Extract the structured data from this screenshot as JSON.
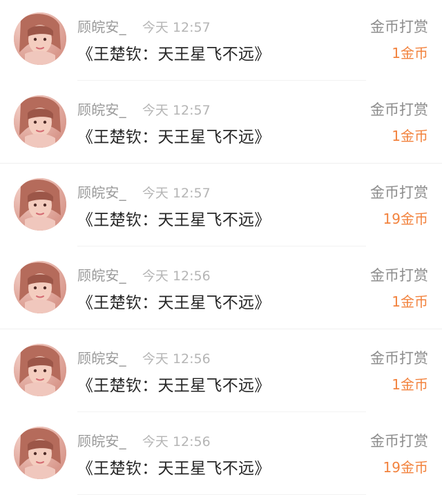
{
  "records": [
    {
      "user": "顾皖安_",
      "time": "今天 12:57",
      "book": "《王楚钦：天王星飞不远》",
      "reward_type": "金币打赏",
      "reward_amount": "1金币"
    },
    {
      "user": "顾皖安_",
      "time": "今天 12:57",
      "book": "《王楚钦：天王星飞不远》",
      "reward_type": "金币打赏",
      "reward_amount": "1金币"
    },
    {
      "user": "顾皖安_",
      "time": "今天 12:57",
      "book": "《王楚钦：天王星飞不远》",
      "reward_type": "金币打赏",
      "reward_amount": "19金币"
    },
    {
      "user": "顾皖安_",
      "time": "今天 12:56",
      "book": "《王楚钦：天王星飞不远》",
      "reward_type": "金币打赏",
      "reward_amount": "1金币"
    },
    {
      "user": "顾皖安_",
      "time": "今天 12:56",
      "book": "《王楚钦：天王星飞不远》",
      "reward_type": "金币打赏",
      "reward_amount": "1金币"
    },
    {
      "user": "顾皖安_",
      "time": "今天 12:56",
      "book": "《王楚钦：天王星飞不远》",
      "reward_type": "金币打赏",
      "reward_amount": "19金币"
    }
  ],
  "colors": {
    "reward_amount": "#f2823d",
    "user_name": "#9b9b9b",
    "timestamp": "#b5b5b5",
    "book_title": "#262626",
    "reward_type": "#8c8c8c"
  },
  "icons": {
    "avatar": "user-avatar-icon"
  }
}
